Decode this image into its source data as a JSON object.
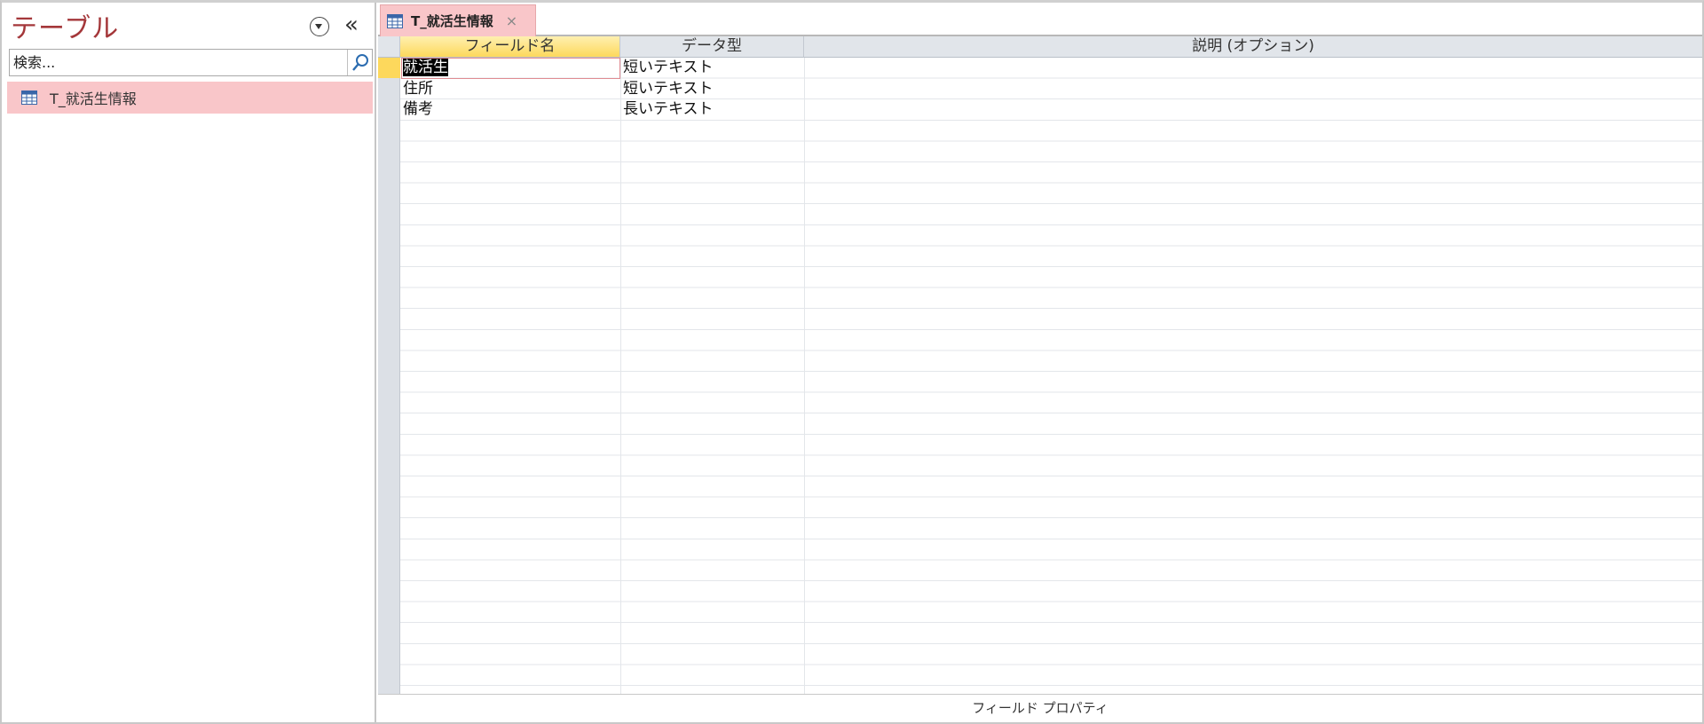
{
  "nav": {
    "title": "テーブル",
    "collapse_glyph": "«",
    "search_placeholder": "検索...",
    "items": [
      {
        "label": "T_就活生情報",
        "icon": "table-icon"
      }
    ]
  },
  "tabs": [
    {
      "label": "T_就活生情報",
      "icon": "table-icon",
      "close_glyph": "×"
    }
  ],
  "grid": {
    "columns": [
      "フィールド名",
      "データ型",
      "説明 (オプション)"
    ],
    "rows": [
      {
        "field": "就活生",
        "type": "短いテキスト",
        "description": ""
      },
      {
        "field": "住所",
        "type": "短いテキスト",
        "description": ""
      },
      {
        "field": "備考",
        "type": "長いテキスト",
        "description": ""
      }
    ]
  },
  "footer": {
    "label": "フィールド プロパティ"
  },
  "colors": {
    "accent": "#a4373a",
    "selection": "#f9c6c9",
    "active_header": "#fdd85c"
  }
}
